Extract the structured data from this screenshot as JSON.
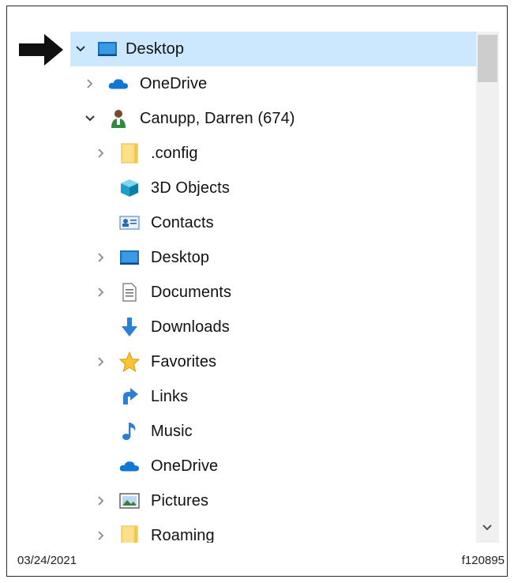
{
  "tree": [
    {
      "label": "Desktop",
      "icon": "desktop-icon",
      "chevron": "expanded",
      "selected": true
    },
    {
      "label": "OneDrive",
      "icon": "onedrive-cloud-icon",
      "chevron": "collapsed"
    },
    {
      "label": "Canupp, Darren (674)",
      "icon": "user-profile-icon",
      "chevron": "expanded"
    },
    {
      "label": ".config",
      "icon": "folder-icon",
      "chevron": "collapsed"
    },
    {
      "label": "3D Objects",
      "icon": "3d-objects-icon",
      "chevron": "none"
    },
    {
      "label": "Contacts",
      "icon": "contacts-icon",
      "chevron": "none"
    },
    {
      "label": "Desktop",
      "icon": "desktop-icon",
      "chevron": "collapsed"
    },
    {
      "label": "Documents",
      "icon": "documents-icon",
      "chevron": "collapsed"
    },
    {
      "label": "Downloads",
      "icon": "downloads-icon",
      "chevron": "none"
    },
    {
      "label": "Favorites",
      "icon": "favorites-star-icon",
      "chevron": "collapsed"
    },
    {
      "label": "Links",
      "icon": "links-icon",
      "chevron": "none"
    },
    {
      "label": "Music",
      "icon": "music-icon",
      "chevron": "none"
    },
    {
      "label": "OneDrive",
      "icon": "onedrive-cloud-icon",
      "chevron": "none"
    },
    {
      "label": "Pictures",
      "icon": "pictures-icon",
      "chevron": "collapsed"
    },
    {
      "label": "Roaming",
      "icon": "folder-icon",
      "chevron": "collapsed"
    }
  ],
  "footer": {
    "date": "03/24/2021",
    "figure_id": "f120895"
  },
  "colors": {
    "selection": "#cce8ff",
    "scrollbar_track": "#f0f0f0",
    "scrollbar_thumb": "#cdcdcd"
  }
}
